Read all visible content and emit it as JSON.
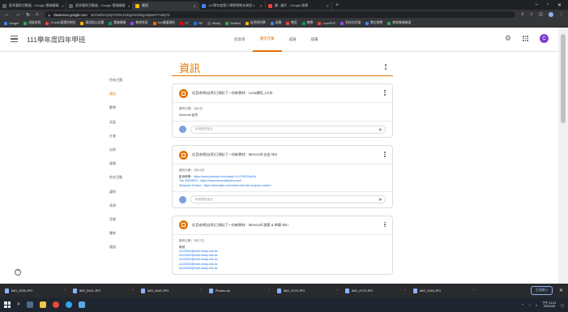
{
  "browser": {
    "tabs": [
      {
        "label": "夏季藝術活動展 - Google 雲端硬碟",
        "active": false
      },
      {
        "label": "夏季藝術活動展 - Google 雲端硬碟",
        "active": false
      },
      {
        "label": "資訊",
        "active": true
      },
      {
        "label": "111學年度第二學期學期末資訊 x",
        "active": false
      },
      {
        "label": "翻 - 圖片 - Google 搜尋",
        "active": false
      }
    ],
    "url_host": "classroom.google.com",
    "url_path": "/u/1/w/NzAyNjYzODc4ODg4/tc/NDg4NjIwNTYwNjY0",
    "bookmarks": [
      "Google",
      "班級首頁",
      "G suite管理控制台",
      "資訊組公告欄",
      "雲端硬碟",
      "教師首頁",
      "sdu會議連結",
      "YT",
      "FB",
      "Windy",
      "BeeBot",
      "自然與科學",
      "試題",
      "教室",
      "教學",
      "LovePDF",
      "科技化評量",
      "數位教學",
      "教育雲端帳號"
    ]
  },
  "classroom": {
    "class_name": "111學年度四年甲班",
    "tabs": [
      "訊息串",
      "課堂作業",
      "成員",
      "成績"
    ],
    "active_tab": "課堂作業",
    "topics": [
      "所有主題",
      "資訊",
      "數學",
      "英語",
      "社會",
      "自然",
      "健康",
      "綜合活動",
      "藝術",
      "表演",
      "音樂",
      "體育",
      "國語"
    ],
    "active_topic": "資訊",
    "section_title": "資訊",
    "comment_placeholder": "新增課堂留言",
    "posts": [
      {
        "title": "佳音老師(自然)已張貼了一份新教材：Luna課程_1/1年",
        "meta": "發布日期：4月4日",
        "lines": [
          "Minecraft 創意",
          ""
        ],
        "links": []
      },
      {
        "title": "佳音老師(自然)已張貼了一份新教材：Minecraft 自由 skin",
        "meta": "發布日期：3月14日",
        "lines": [
          "影音教學："
        ],
        "links": [
          "https://www.youtube.com/watch?v=ZYtDO9o9Jo",
          "The SKINDEX : https://www.minecraftskins.com/",
          "Skinpack Creator : https://skinmyke.com/minecraft-skin-recipes-creator/"
        ]
      },
      {
        "title": "佳音老師(自然)已張貼了一份新教材：Minecraft 建築 & 參觀 skin",
        "meta": "發布日期：3月17日",
        "lines": [
          "帳號"
        ],
        "links": [
          "s1100001@mail.chiayi.edu.tw",
          "s1100002@mail.chiayi.edu.tw",
          "s1100003@mail.chiayi.edu.tw",
          "s1100004@mail.chiayi.edu.tw",
          "s1100005@mail.chiayi.edu.tw"
        ]
      }
    ]
  },
  "downloads": {
    "files": [
      "IMG_2535.JPG",
      "IMG_5441.JPG",
      "IMG_5440.JPG",
      "Photos.zip",
      "IMG_2176.JPG",
      "IMG_2175.JPG",
      "IMG_2183.JPG"
    ],
    "show_all": "全部顯示"
  },
  "taskbar": {
    "time": "下午 11:41",
    "date": "2023/4/8"
  },
  "colors": {
    "accent": "#e37400",
    "link": "#1a73e8",
    "chrome_dark": "#202124"
  }
}
